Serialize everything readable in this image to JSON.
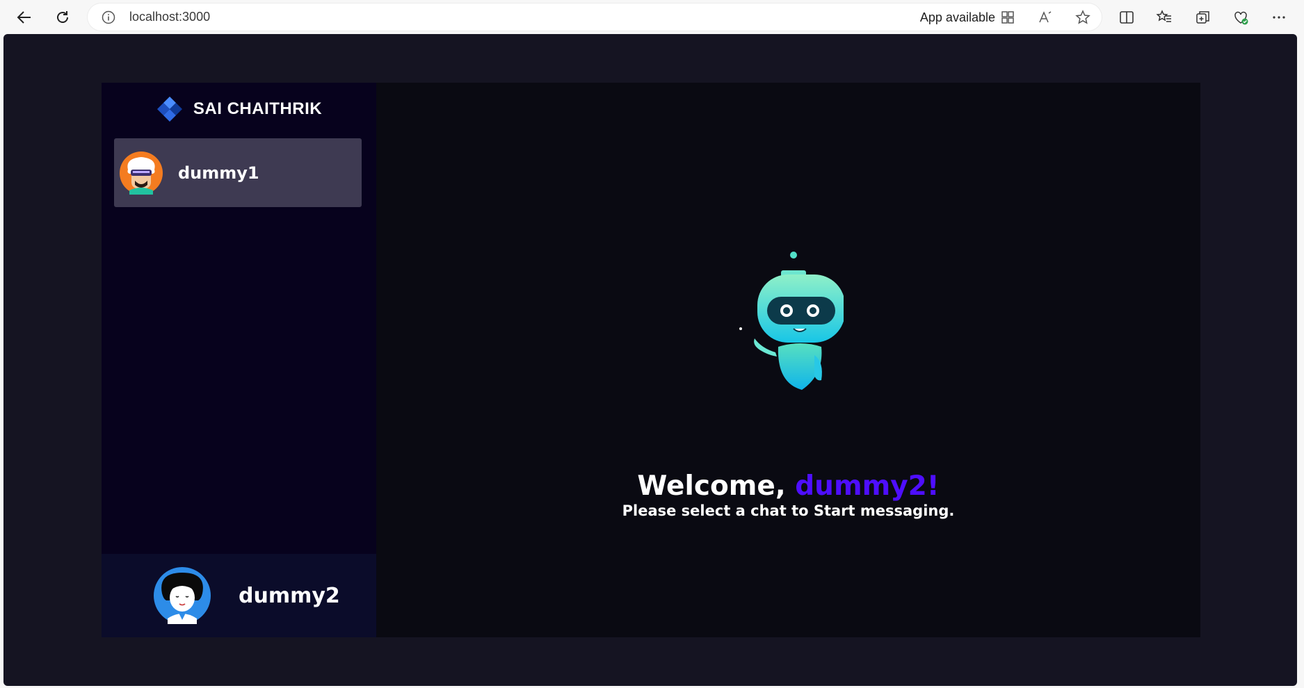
{
  "browser": {
    "url": "localhost:3000",
    "app_available_label": "App available",
    "icons": [
      "back-icon",
      "refresh-icon",
      "info-icon",
      "app-install-icon",
      "read-aloud-icon",
      "favorite-star-icon",
      "split-screen-icon",
      "favorites-icon",
      "collections-icon",
      "browser-essentials-icon",
      "more-icon"
    ]
  },
  "sidebar": {
    "brand": "SAI CHAITHRIK",
    "contacts": [
      {
        "name": "dummy1",
        "selected": true
      }
    ],
    "current_user": {
      "name": "dummy2"
    }
  },
  "welcome": {
    "greeting": "Welcome, ",
    "username": "dummy2!",
    "subtitle": "Please select a chat to Start messaging."
  },
  "colors": {
    "accent": "#4e0eff",
    "sidebar_bg": "#07021d",
    "contact_selected_bg": "#3e3a52",
    "current_user_bg": "#0b0c2a",
    "page_bg": "#151422"
  }
}
